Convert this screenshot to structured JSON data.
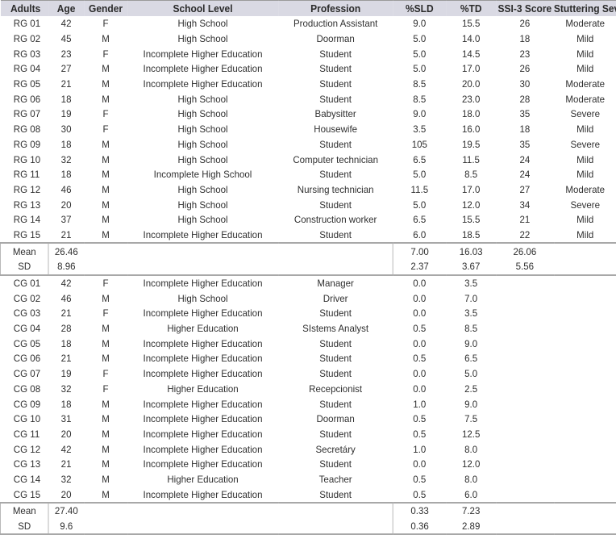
{
  "table": {
    "headers": {
      "adults": "Adults",
      "age": "Age",
      "gender": "Gender",
      "school": "School Level",
      "profession": "Profession",
      "sld": "%SLD",
      "td": "%TD",
      "ssi": "SSI-3 Score",
      "severity": "Stuttering Severity"
    },
    "rg": [
      {
        "id": "RG 01",
        "age": "42",
        "gender": "F",
        "school": "High School",
        "profession": "Production Assistant",
        "sld": "9.0",
        "td": "15.5",
        "ssi": "26",
        "severity": "Moderate"
      },
      {
        "id": "RG 02",
        "age": "45",
        "gender": "M",
        "school": "High School",
        "profession": "Doorman",
        "sld": "5.0",
        "td": "14.0",
        "ssi": "18",
        "severity": "Mild"
      },
      {
        "id": "RG 03",
        "age": "23",
        "gender": "F",
        "school": "Incomplete Higher Education",
        "profession": "Student",
        "sld": "5.0",
        "td": "14.5",
        "ssi": "23",
        "severity": "Mild"
      },
      {
        "id": "RG 04",
        "age": "27",
        "gender": "M",
        "school": "Incomplete Higher Education",
        "profession": "Student",
        "sld": "5.0",
        "td": "17.0",
        "ssi": "26",
        "severity": "Mild"
      },
      {
        "id": "RG 05",
        "age": "21",
        "gender": "M",
        "school": "Incomplete Higher Education",
        "profession": "Student",
        "sld": "8.5",
        "td": "20.0",
        "ssi": "30",
        "severity": "Moderate"
      },
      {
        "id": "RG 06",
        "age": "18",
        "gender": "M",
        "school": "High School",
        "profession": "Student",
        "sld": "8.5",
        "td": "23.0",
        "ssi": "28",
        "severity": "Moderate"
      },
      {
        "id": "RG 07",
        "age": "19",
        "gender": "F",
        "school": "High School",
        "profession": "Babysitter",
        "sld": "9.0",
        "td": "18.0",
        "ssi": "35",
        "severity": "Severe"
      },
      {
        "id": "RG 08",
        "age": "30",
        "gender": "F",
        "school": "High School",
        "profession": "Housewife",
        "sld": "3.5",
        "td": "16.0",
        "ssi": "18",
        "severity": "Mild"
      },
      {
        "id": "RG 09",
        "age": "18",
        "gender": "M",
        "school": "High School",
        "profession": "Student",
        "sld": "105",
        "td": "19.5",
        "ssi": "35",
        "severity": "Severe"
      },
      {
        "id": "RG 10",
        "age": "32",
        "gender": "M",
        "school": "High School",
        "profession": "Computer technician",
        "sld": "6.5",
        "td": "11.5",
        "ssi": "24",
        "severity": "Mild"
      },
      {
        "id": "RG 11",
        "age": "18",
        "gender": "M",
        "school": "Incomplete High School",
        "profession": "Student",
        "sld": "5.0",
        "td": "8.5",
        "ssi": "24",
        "severity": "Mild"
      },
      {
        "id": "RG 12",
        "age": "46",
        "gender": "M",
        "school": "High School",
        "profession": "Nursing technician",
        "sld": "11.5",
        "td": "17.0",
        "ssi": "27",
        "severity": "Moderate"
      },
      {
        "id": "RG 13",
        "age": "20",
        "gender": "M",
        "school": "High School",
        "profession": "Student",
        "sld": "5.0",
        "td": "12.0",
        "ssi": "34",
        "severity": "Severe"
      },
      {
        "id": "RG 14",
        "age": "37",
        "gender": "M",
        "school": "High School",
        "profession": "Construction worker",
        "sld": "6.5",
        "td": "15.5",
        "ssi": "21",
        "severity": "Mild"
      },
      {
        "id": "RG 15",
        "age": "21",
        "gender": "M",
        "school": "Incomplete Higher Education",
        "profession": "Student",
        "sld": "6.0",
        "td": "18.5",
        "ssi": "22",
        "severity": "Mild"
      }
    ],
    "rg_mean": {
      "label": "Mean",
      "age": "26.46",
      "sld": "7.00",
      "td": "16.03",
      "ssi": "26.06"
    },
    "rg_sd": {
      "label": "SD",
      "age": "8.96",
      "sld": "2.37",
      "td": "3.67",
      "ssi": "5.56"
    },
    "cg": [
      {
        "id": "CG 01",
        "age": "42",
        "gender": "F",
        "school": "Incomplete Higher Education",
        "profession": "Manager",
        "sld": "0.0",
        "td": "3.5"
      },
      {
        "id": "CG 02",
        "age": "46",
        "gender": "M",
        "school": "High School",
        "profession": "Driver",
        "sld": "0.0",
        "td": "7.0"
      },
      {
        "id": "CG 03",
        "age": "21",
        "gender": "F",
        "school": "Incomplete Higher Education",
        "profession": "Student",
        "sld": "0.0",
        "td": "3.5"
      },
      {
        "id": "CG 04",
        "age": "28",
        "gender": "M",
        "school": "Higher Education",
        "profession": "SIstems Analyst",
        "sld": "0.5",
        "td": "8.5"
      },
      {
        "id": "CG 05",
        "age": "18",
        "gender": "M",
        "school": "Incomplete Higher Education",
        "profession": "Student",
        "sld": "0.0",
        "td": "9.0"
      },
      {
        "id": "CG 06",
        "age": "21",
        "gender": "M",
        "school": "Incomplete Higher Education",
        "profession": "Student",
        "sld": "0.5",
        "td": "6.5"
      },
      {
        "id": "CG 07",
        "age": "19",
        "gender": "F",
        "school": "Incomplete Higher Education",
        "profession": "Student",
        "sld": "0.0",
        "td": "5.0"
      },
      {
        "id": "CG 08",
        "age": "32",
        "gender": "F",
        "school": "Higher Education",
        "profession": "Recepcionist",
        "sld": "0.0",
        "td": "2.5"
      },
      {
        "id": "CG 09",
        "age": "18",
        "gender": "M",
        "school": "Incomplete Higher Education",
        "profession": "Student",
        "sld": "1.0",
        "td": "9.0"
      },
      {
        "id": "CG 10",
        "age": "31",
        "gender": "M",
        "school": "Incomplete Higher Education",
        "profession": "Doorman",
        "sld": "0.5",
        "td": "7.5"
      },
      {
        "id": "CG 11",
        "age": "20",
        "gender": "M",
        "school": "Incomplete Higher Education",
        "profession": "Student",
        "sld": "0.5",
        "td": "12.5"
      },
      {
        "id": "CG 12",
        "age": "42",
        "gender": "M",
        "school": "Incomplete Higher Education",
        "profession": "Secretáry",
        "sld": "1.0",
        "td": "8.0"
      },
      {
        "id": "CG 13",
        "age": "21",
        "gender": "M",
        "school": "Incomplete Higher Education",
        "profession": "Student",
        "sld": "0.0",
        "td": "12.0"
      },
      {
        "id": "CG 14",
        "age": "32",
        "gender": "M",
        "school": "Higher Education",
        "profession": "Teacher",
        "sld": "0.5",
        "td": "8.0"
      },
      {
        "id": "CG 15",
        "age": "20",
        "gender": "M",
        "school": "Incomplete Higher Education",
        "profession": "Student",
        "sld": "0.5",
        "td": "6.0"
      }
    ],
    "cg_mean": {
      "label": "Mean",
      "age": "27.40",
      "sld": "0.33",
      "td": "7.23"
    },
    "cg_sd": {
      "label": "SD",
      "age": "9.6",
      "sld": "0.36",
      "td": "2.89"
    }
  }
}
